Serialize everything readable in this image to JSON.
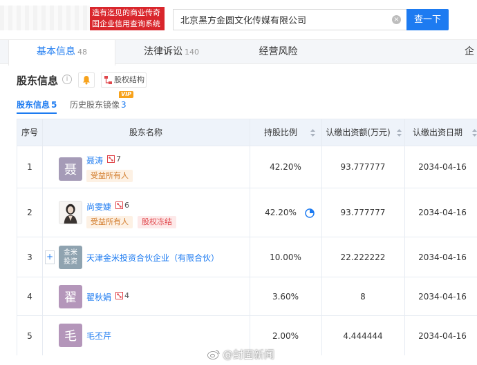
{
  "header": {
    "brand_line1": "造有迄见的商业传奇",
    "brand_line2": "国企业信用查询系统",
    "search_value": "北京黑方金圆文化传媒有限公司",
    "search_button": "查一下",
    "accent_color": "#1d7bf1",
    "brand_color": "#d9262c"
  },
  "tabs": [
    {
      "label": "基本信息",
      "count": "48"
    },
    {
      "label": "法律诉讼",
      "count": "140"
    },
    {
      "label": "经营风险",
      "count": ""
    },
    {
      "label": "企",
      "count": ""
    }
  ],
  "section": {
    "title": "股东信息",
    "info_icon_glyph": "i",
    "equity_button": "股权结构",
    "subtabs": [
      {
        "label": "股东信息",
        "count": "5"
      },
      {
        "label": "历史股东镜像",
        "count": "3"
      }
    ],
    "vip_label": "VIP"
  },
  "table": {
    "columns": [
      "序号",
      "股东名称",
      "持股比例",
      "认缴出资额(万元)",
      "认缴出资日期"
    ],
    "rows": [
      {
        "index": "1",
        "name": "聂涛",
        "avatar_text": "聂",
        "avatar_color": "#a59bb7",
        "relations": "7",
        "tags": [
          "受益所有人"
        ],
        "ratio": "42.20%",
        "amount": "93.777777",
        "date": "2034-04-16"
      },
      {
        "index": "2",
        "name": "尚雯婕",
        "avatar_text": "",
        "avatar_color": "#ffffff",
        "relations": "6",
        "tags": [
          "受益所有人",
          "股权冻结"
        ],
        "ratio": "42.20%",
        "amount": "93.777777",
        "date": "2034-04-16"
      },
      {
        "index": "3",
        "name": "天津金米投资合伙企业（有限合伙）",
        "avatar_text_1": "金米",
        "avatar_text_2": "投资",
        "avatar_color": "#8fa3b0",
        "ratio": "10.00%",
        "amount": "22.222222",
        "date": "2034-04-16"
      },
      {
        "index": "4",
        "name": "翟秋娟",
        "avatar_text": "翟",
        "avatar_color": "#b496ba",
        "relations": "4",
        "ratio": "3.60%",
        "amount": "8",
        "date": "2034-04-16"
      },
      {
        "index": "5",
        "name": "毛丕芹",
        "avatar_text": "毛",
        "avatar_color": "#b496ba",
        "ratio": "2.00%",
        "amount": "4.444444",
        "date": "2034-04-16"
      }
    ],
    "expand_glyph": "+"
  },
  "watermark": "@封面新闻"
}
